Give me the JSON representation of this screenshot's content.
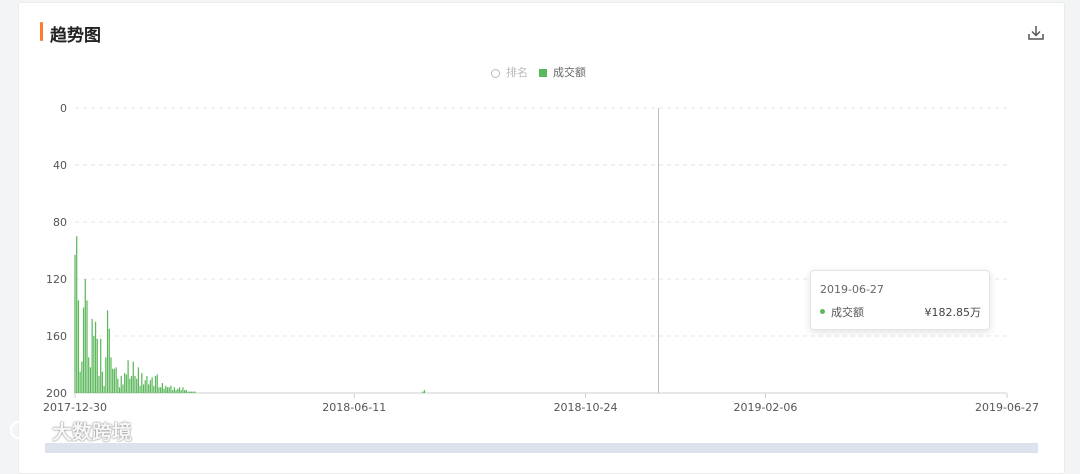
{
  "header": {
    "title": "趋势图",
    "download_icon": "download-icon"
  },
  "legend": [
    {
      "label": "排名",
      "marker": "hollow-circle",
      "color": "#bbbbbb"
    },
    {
      "label": "成交额",
      "marker": "square",
      "color": "#5cb85c"
    }
  ],
  "tooltip": {
    "date": "2019-06-27",
    "series": "成交额",
    "value": "¥182.85万"
  },
  "watermark": {
    "text": "大数跨境"
  },
  "chart_data": {
    "type": "bar",
    "x_axis": {
      "type": "date",
      "range": [
        "2017-12-30",
        "2019-06-27"
      ],
      "tick_labels": [
        "2017-12-30",
        "2018-06-11",
        "2018-10-24",
        "2019-02-06",
        "2019-06-27"
      ]
    },
    "y_axis": {
      "inverted": true,
      "range": [
        0,
        200
      ],
      "tick_labels": [
        "0",
        "40",
        "80",
        "120",
        "160",
        "200"
      ],
      "ticks": [
        0,
        40,
        80,
        120,
        160,
        200
      ]
    },
    "grid": "horizontal dashed",
    "hover_date": "2019-06-27",
    "series": [
      {
        "name": "成交额",
        "color": "#5cb85c",
        "values": [
          103,
          90,
          135,
          185,
          178,
          140,
          120,
          135,
          175,
          182,
          148,
          160,
          150,
          162,
          188,
          162,
          185,
          195,
          175,
          142,
          155,
          175,
          183,
          183,
          182,
          190,
          196,
          188,
          194,
          186,
          187,
          177,
          190,
          188,
          178,
          188,
          190,
          182,
          195,
          186,
          194,
          191,
          188,
          194,
          191,
          189,
          195,
          188,
          187,
          196,
          196,
          193,
          197,
          195,
          196,
          196,
          195,
          198,
          196,
          198,
          197,
          196,
          198,
          196,
          198,
          198,
          199,
          199,
          199,
          199,
          199
        ],
        "later_values": [
          199,
          198
        ]
      }
    ]
  }
}
